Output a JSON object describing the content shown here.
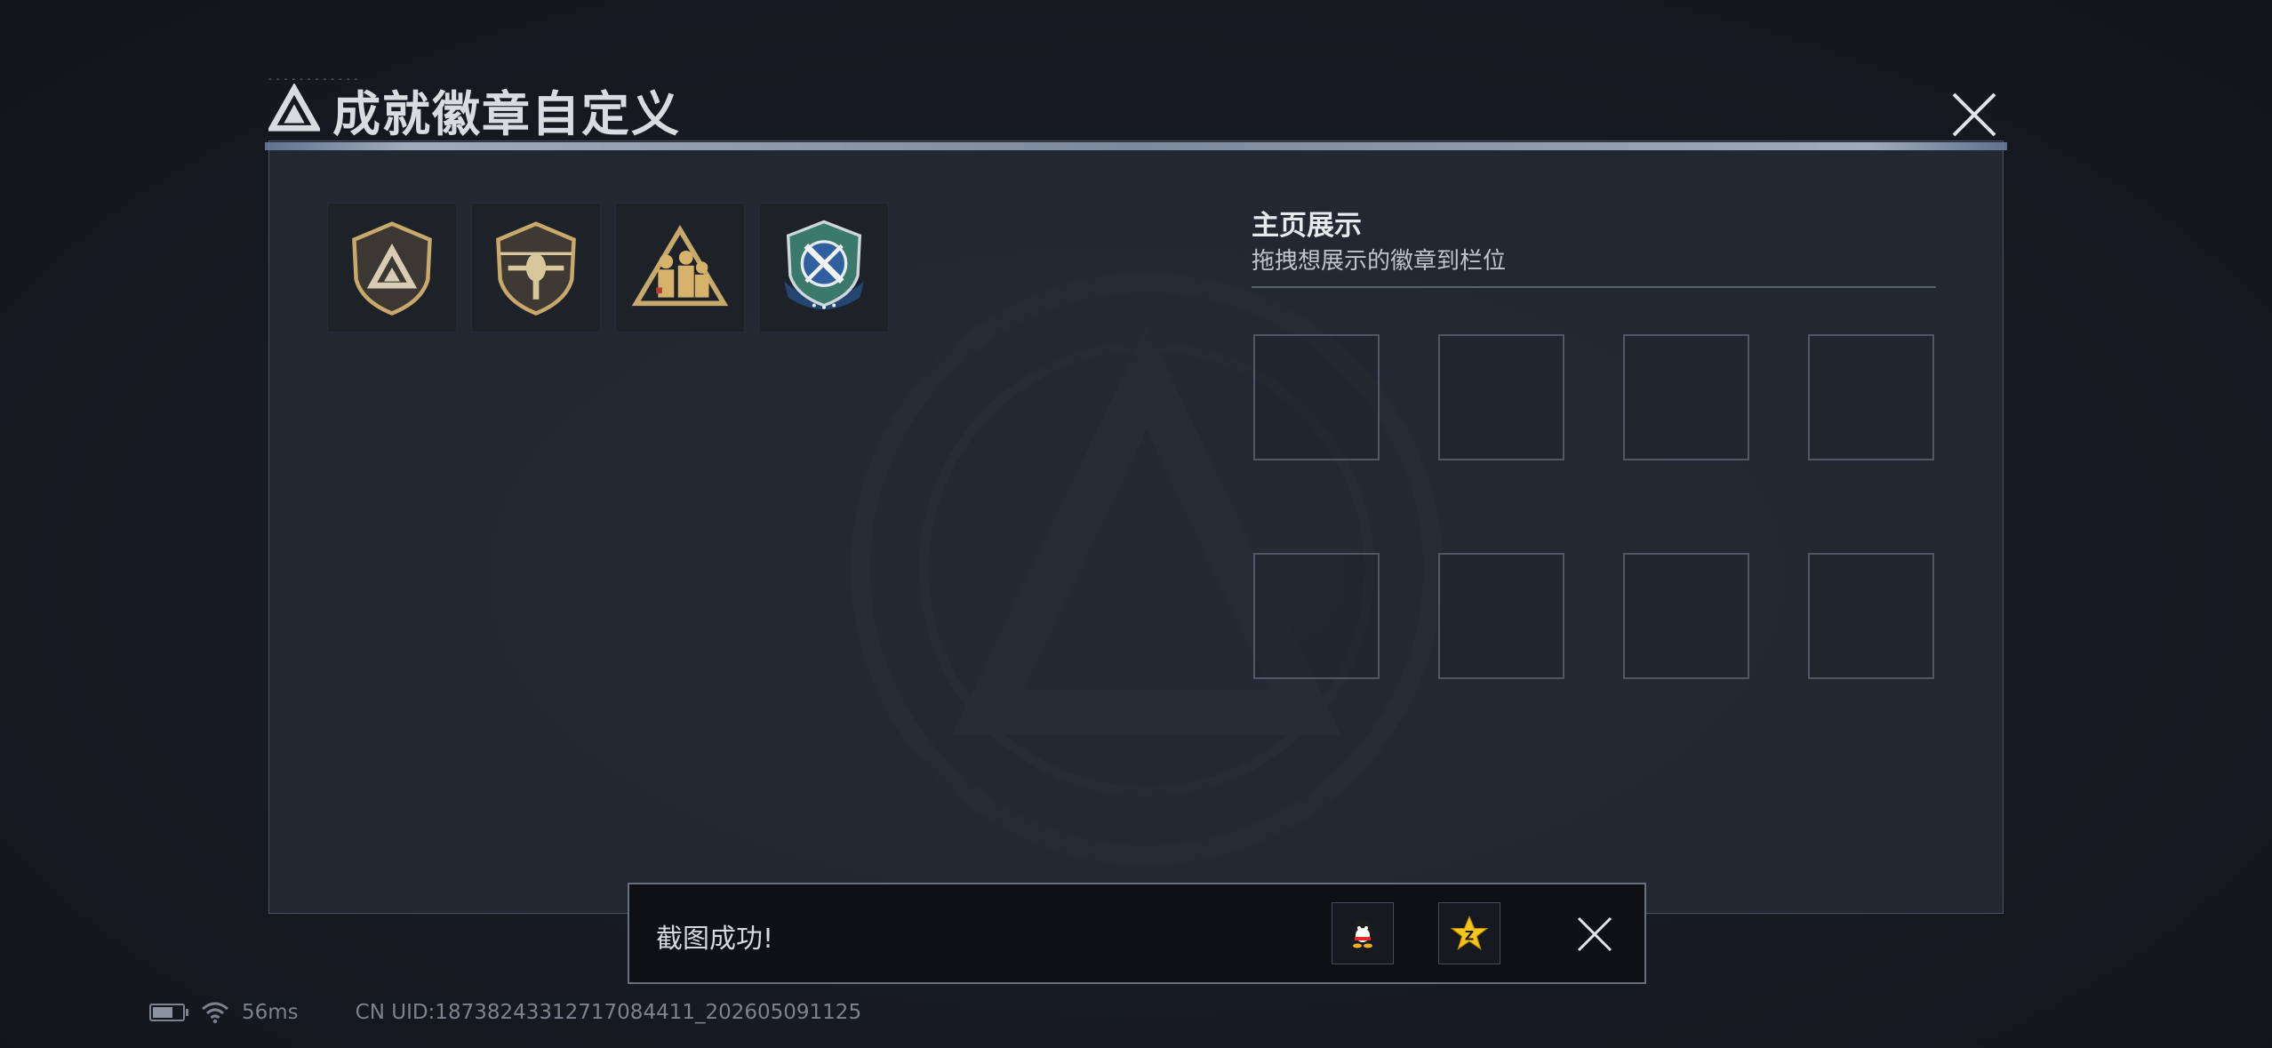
{
  "header": {
    "title": "成就徽章自定义",
    "close_icon": "close-icon"
  },
  "badges": [
    {
      "name": "triangle-emblem-badge",
      "icon": "triangle-logo-shield"
    },
    {
      "name": "helicopter-badge",
      "icon": "attack-helicopter-shield"
    },
    {
      "name": "squad-badge",
      "icon": "soldiers-triangle"
    },
    {
      "name": "sniper-badge",
      "icon": "crossed-missiles-shield"
    }
  ],
  "showcase": {
    "title": "主页展示",
    "subtitle": "拖拽想展示的徽章到栏位",
    "slot_count": 8
  },
  "toast": {
    "message": "截图成功!",
    "share_options": [
      "qq-icon",
      "qzone-icon"
    ]
  },
  "status_bar": {
    "battery_level": 0.7,
    "latency": "56ms",
    "uid": "CN UID:18738243312717084411_202605091125"
  },
  "colors": {
    "gold": "#c9a96b",
    "panel": "#262c36",
    "accent_blue": "#2f5f9e"
  }
}
